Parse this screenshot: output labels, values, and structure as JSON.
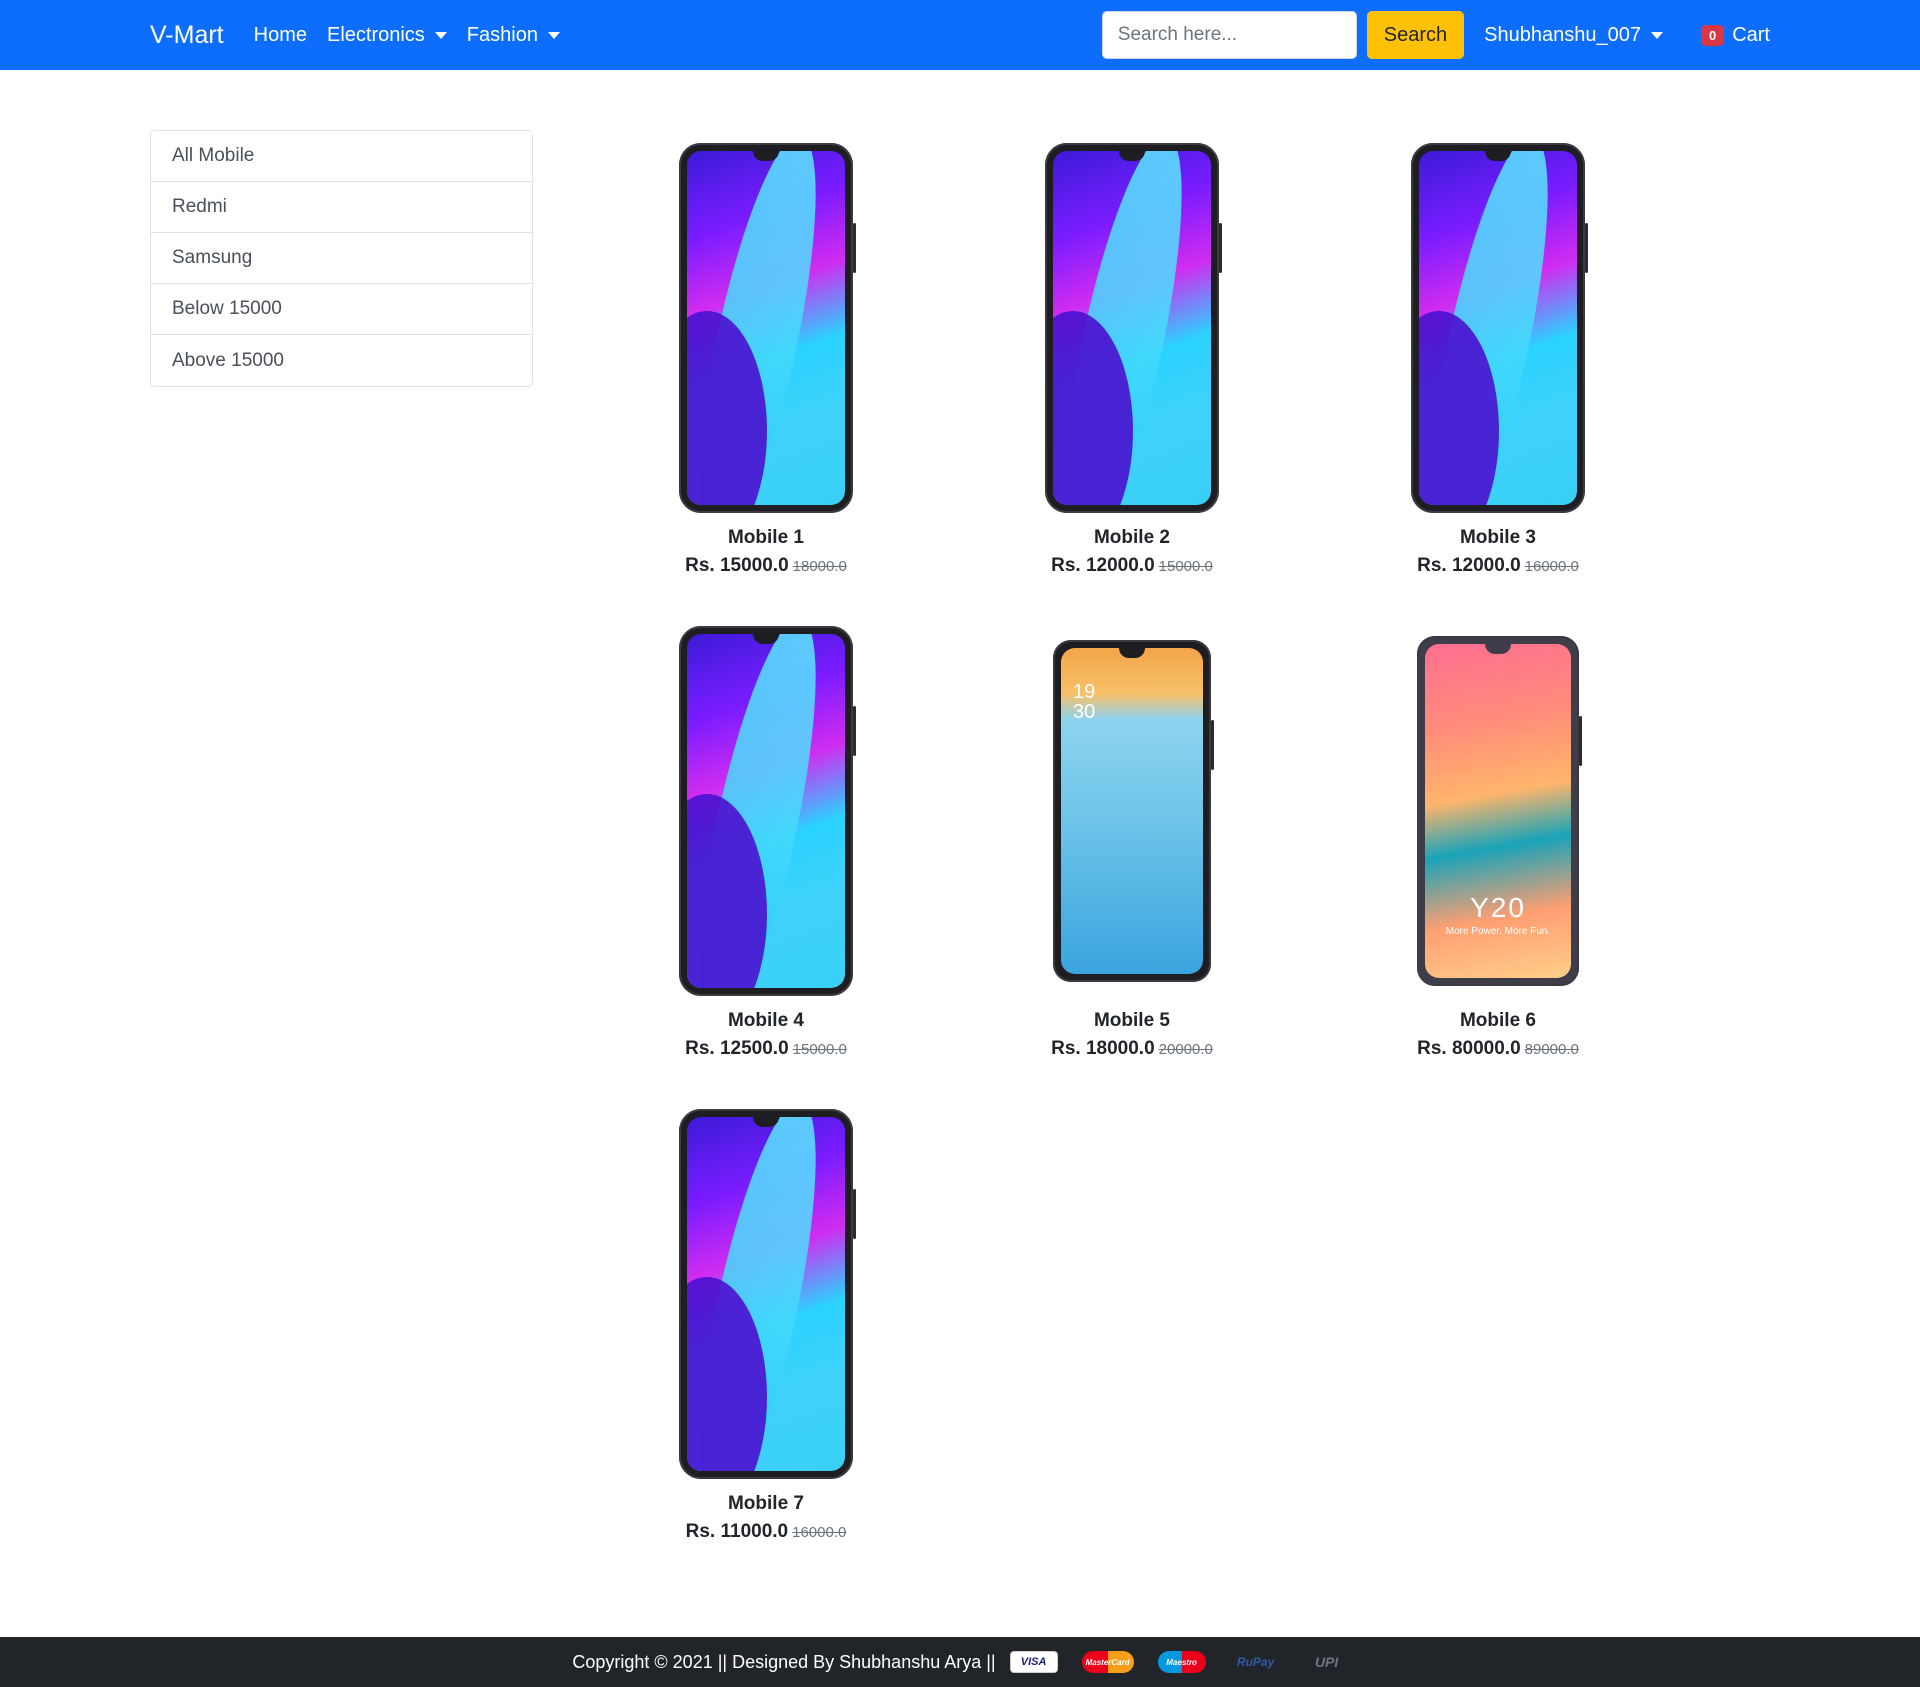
{
  "navbar": {
    "brand": "V-Mart",
    "links": {
      "home": "Home",
      "electronics": "Electronics",
      "fashion": "Fashion"
    },
    "search": {
      "placeholder": "Search here...",
      "button": "Search"
    },
    "user": "Shubhanshu_007",
    "cart": {
      "count": "0",
      "label": "Cart"
    }
  },
  "sidebar": {
    "items": [
      {
        "label": "All Mobile"
      },
      {
        "label": "Redmi"
      },
      {
        "label": "Samsung"
      },
      {
        "label": "Below 15000"
      },
      {
        "label": "Above 15000"
      }
    ]
  },
  "products": [
    {
      "name": "Mobile 1",
      "price": "Rs. 15000.0",
      "old_price": "18000.0",
      "image": "redmi-phone"
    },
    {
      "name": "Mobile 2",
      "price": "Rs. 12000.0",
      "old_price": "15000.0",
      "image": "redmi-phone"
    },
    {
      "name": "Mobile 3",
      "price": "Rs. 12000.0",
      "old_price": "16000.0",
      "image": "redmi-phone"
    },
    {
      "name": "Mobile 4",
      "price": "Rs. 12500.0",
      "old_price": "15000.0",
      "image": "redmi-phone"
    },
    {
      "name": "Mobile 5",
      "price": "Rs. 18000.0",
      "old_price": "20000.0",
      "image": "oppo-phone",
      "screen_clock": [
        "19",
        "30"
      ]
    },
    {
      "name": "Mobile 6",
      "price": "Rs. 80000.0",
      "old_price": "89000.0",
      "image": "vivo-phone",
      "screen_title": "Y20",
      "screen_subtitle": "More Power. More Fun."
    },
    {
      "name": "Mobile 7",
      "price": "Rs. 11000.0",
      "old_price": "16000.0",
      "image": "redmi-phone"
    }
  ],
  "footer": {
    "text": "Copyright © 2021 || Designed By Shubhanshu Arya ||",
    "payments": {
      "visa": "VISA",
      "mastercard": "MasterCard",
      "maestro": "Maestro",
      "rupay": "RuPay",
      "upi": "UPI"
    }
  },
  "colors": {
    "navbar": "#0d6efd",
    "search_button": "#ffc107",
    "badge": "#dc3545",
    "footer": "#212529"
  }
}
